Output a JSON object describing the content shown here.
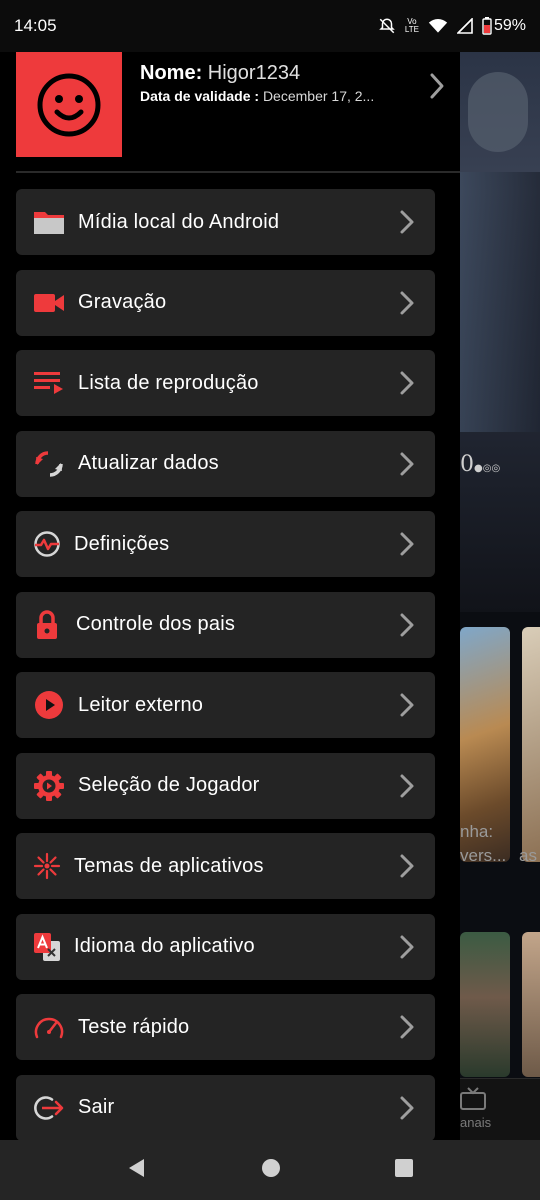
{
  "status_bar": {
    "time": "14:05",
    "network": "Vo LTE",
    "battery": "59%",
    "icons": [
      "mute-notifications-icon",
      "volte-icon",
      "wifi-icon",
      "signal-icon",
      "battery-icon"
    ]
  },
  "profile": {
    "name_label": "Nome:",
    "name_value": "Higor1234",
    "expiry_label": "Data de validade :",
    "expiry_value": "December 17, 2..."
  },
  "menu": [
    {
      "label": "Mídia local do Android",
      "icon": "folder-icon"
    },
    {
      "label": "Gravação",
      "icon": "video-camera-icon"
    },
    {
      "label": "Lista de reprodução",
      "icon": "playlist-icon"
    },
    {
      "label": "Atualizar dados",
      "icon": "refresh-icon"
    },
    {
      "label": "Definições",
      "icon": "settings-pulse-icon"
    },
    {
      "label": "Controle dos pais",
      "icon": "lock-icon"
    },
    {
      "label": "Leitor externo",
      "icon": "play-circle-icon"
    },
    {
      "label": "Seleção de Jogador",
      "icon": "player-gear-icon"
    },
    {
      "label": "Temas de aplicativos",
      "icon": "themes-burst-icon"
    },
    {
      "label": "Idioma do aplicativo",
      "icon": "translate-icon"
    },
    {
      "label": "Teste rápido",
      "icon": "speedometer-icon"
    },
    {
      "label": "Sair",
      "icon": "logout-icon"
    }
  ],
  "background": {
    "rating_text": "0",
    "poster_caption_line1": "nha:",
    "poster_caption_line2": "vers...",
    "poster_caption_side": "as",
    "tab_label": "anais"
  },
  "colors": {
    "accent": "#ee3a3c",
    "item_bg": "#242424",
    "drawer_bg": "#000000",
    "chevron": "#9e9e9e"
  }
}
